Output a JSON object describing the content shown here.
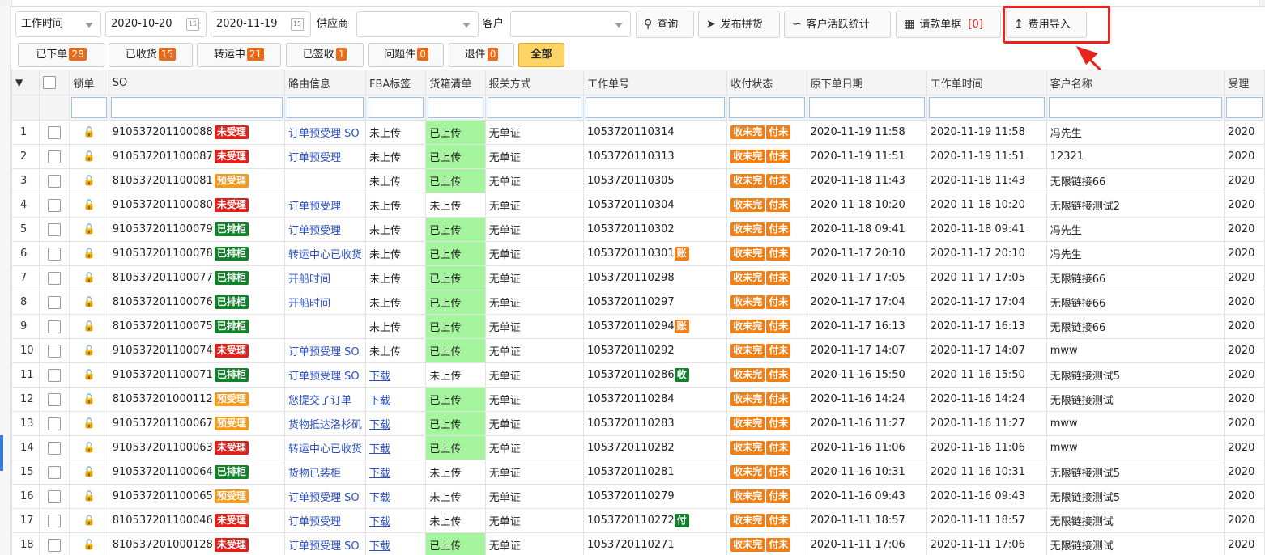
{
  "toolbar": {
    "date_type": "工作时间",
    "date_from": "2020-10-20",
    "date_to": "2020-11-19",
    "supplier_label": "供应商",
    "supplier_value": "",
    "customer_label": "客户",
    "customer_value": "",
    "query_label": "查询",
    "publish_label": "发布拼货",
    "stats_label": "客户活跃统计",
    "invoice_label": "请款单据",
    "invoice_count": "[0]",
    "import_label": "费用导入"
  },
  "status_tabs": [
    {
      "label": "已下单",
      "count": "28"
    },
    {
      "label": "已收货",
      "count": "15"
    },
    {
      "label": "转运中",
      "count": "21"
    },
    {
      "label": "已签收",
      "count": "1"
    },
    {
      "label": "问题件",
      "count": "0"
    },
    {
      "label": "退件",
      "count": "0"
    },
    {
      "label": "全部",
      "count": ""
    }
  ],
  "columns": [
    "锁单",
    "SO",
    "路由信息",
    "FBA标签",
    "货箱清单",
    "报关方式",
    "工作单号",
    "收付状态",
    "原下单日期",
    "工作单时间",
    "客户名称",
    "受理"
  ],
  "status_colors": {
    "未受理": "#e0201a",
    "预受理": "#f39a1a",
    "已排柜": "#12822a",
    "账": "#ef7f17",
    "收": "#12822a",
    "付": "#12822a",
    "uploaded_bg": "#a5f59e",
    "highlight": "#e8241c"
  },
  "receive_label": "收未完",
  "pay_label": "付未",
  "rows": [
    {
      "no": "1",
      "so": "910537201100088",
      "status": "未受理",
      "route": "订单预受理 SO",
      "fba": "未上传",
      "box": "已上传",
      "customs": "无单证",
      "work": "1053720110314",
      "badge": "",
      "orig": "2020-11-19 11:58",
      "wtime": "2020-11-19 11:58",
      "cust": "冯先生",
      "acc": "2020"
    },
    {
      "no": "2",
      "so": "910537201100087",
      "status": "未受理",
      "route": "订单预受理",
      "fba": "未上传",
      "box": "已上传",
      "customs": "无单证",
      "work": "1053720110313",
      "badge": "",
      "orig": "2020-11-19 11:51",
      "wtime": "2020-11-19 11:51",
      "cust": "12321",
      "acc": "2020"
    },
    {
      "no": "3",
      "so": "810537201100081",
      "status": "预受理",
      "route": "",
      "fba": "未上传",
      "box": "已上传",
      "customs": "无单证",
      "work": "1053720110305",
      "badge": "",
      "orig": "2020-11-18 11:43",
      "wtime": "2020-11-18 11:43",
      "cust": "无限链接66",
      "acc": "2020"
    },
    {
      "no": "4",
      "so": "910537201100080",
      "status": "未受理",
      "route": "订单预受理",
      "fba": "未上传",
      "box": "未上传",
      "customs": "无单证",
      "work": "1053720110304",
      "badge": "",
      "orig": "2020-11-18 10:20",
      "wtime": "2020-11-18 10:20",
      "cust": "无限链接测试2",
      "acc": "2020"
    },
    {
      "no": "5",
      "so": "910537201100079",
      "status": "已排柜",
      "route": "订单预受理",
      "fba": "未上传",
      "box": "已上传",
      "customs": "无单证",
      "work": "1053720110302",
      "badge": "",
      "orig": "2020-11-18 09:41",
      "wtime": "2020-11-18 09:41",
      "cust": "冯先生",
      "acc": "2020"
    },
    {
      "no": "6",
      "so": "910537201100078",
      "status": "已排柜",
      "route": "转运中心已收货",
      "fba": "未上传",
      "box": "已上传",
      "customs": "无单证",
      "work": "1053720110301",
      "badge": "账",
      "orig": "2020-11-17 20:10",
      "wtime": "2020-11-17 20:10",
      "cust": "冯先生",
      "acc": "2020"
    },
    {
      "no": "7",
      "so": "810537201100077",
      "status": "已排柜",
      "route": "开船时间",
      "fba": "未上传",
      "box": "已上传",
      "customs": "无单证",
      "work": "1053720110298",
      "badge": "",
      "orig": "2020-11-17 17:05",
      "wtime": "2020-11-17 17:05",
      "cust": "无限链接66",
      "acc": "2020"
    },
    {
      "no": "8",
      "so": "810537201100076",
      "status": "已排柜",
      "route": "开船时间",
      "fba": "未上传",
      "box": "已上传",
      "customs": "无单证",
      "work": "1053720110297",
      "badge": "",
      "orig": "2020-11-17 17:04",
      "wtime": "2020-11-17 17:04",
      "cust": "无限链接66",
      "acc": "2020"
    },
    {
      "no": "9",
      "so": "810537201100075",
      "status": "已排柜",
      "route": "",
      "fba": "未上传",
      "box": "已上传",
      "customs": "无单证",
      "work": "1053720110294",
      "badge": "账",
      "orig": "2020-11-17 16:13",
      "wtime": "2020-11-17 16:13",
      "cust": "无限链接66",
      "acc": "2020"
    },
    {
      "no": "10",
      "so": "910537201100074",
      "status": "未受理",
      "route": "订单预受理 SO",
      "fba": "未上传",
      "box": "已上传",
      "customs": "无单证",
      "work": "1053720110292",
      "badge": "",
      "orig": "2020-11-17 14:07",
      "wtime": "2020-11-17 14:07",
      "cust": "mww",
      "acc": "2020"
    },
    {
      "no": "11",
      "so": "910537201100071",
      "status": "已排柜",
      "route": "订单预受理 SO",
      "fba": "下载",
      "box": "未上传",
      "customs": "无单证",
      "work": "1053720110286",
      "badge": "收",
      "orig": "2020-11-16 15:50",
      "wtime": "2020-11-16 15:50",
      "cust": "无限链接测试5",
      "acc": "2020"
    },
    {
      "no": "12",
      "so": "810537201000112",
      "status": "预受理",
      "route": "您提交了订单",
      "fba": "下载",
      "box": "已上传",
      "customs": "无单证",
      "work": "1053720110284",
      "badge": "",
      "orig": "2020-11-16 14:24",
      "wtime": "2020-11-16 14:24",
      "cust": "无限链接测试",
      "acc": "2020"
    },
    {
      "no": "13",
      "so": "910537201100067",
      "status": "预受理",
      "route": "货物抵达洛杉矶",
      "fba": "下载",
      "box": "已上传",
      "customs": "无单证",
      "work": "1053720110283",
      "badge": "",
      "orig": "2020-11-16 11:27",
      "wtime": "2020-11-16 11:27",
      "cust": "mww",
      "acc": "2020"
    },
    {
      "no": "14",
      "so": "910537201100063",
      "status": "未受理",
      "route": "转运中心已收货",
      "fba": "下载",
      "box": "已上传",
      "customs": "无单证",
      "work": "1053720110282",
      "badge": "",
      "orig": "2020-11-16 11:06",
      "wtime": "2020-11-16 11:06",
      "cust": "mww",
      "acc": "2020"
    },
    {
      "no": "15",
      "so": "910537201100064",
      "status": "已排柜",
      "route": "货物已装柜",
      "fba": "下载",
      "box": "未上传",
      "customs": "无单证",
      "work": "1053720110281",
      "badge": "",
      "orig": "2020-11-16 10:31",
      "wtime": "2020-11-16 10:31",
      "cust": "无限链接测试5",
      "acc": "2020"
    },
    {
      "no": "16",
      "so": "910537201100065",
      "status": "预受理",
      "route": "订单预受理 SO",
      "fba": "下载",
      "box": "未上传",
      "customs": "无单证",
      "work": "1053720110279",
      "badge": "",
      "orig": "2020-11-16 09:43",
      "wtime": "2020-11-16 09:43",
      "cust": "无限链接测试5",
      "acc": "2020"
    },
    {
      "no": "17",
      "so": "810537201100046",
      "status": "未受理",
      "route": "订单预受理",
      "fba": "下载",
      "box": "未上传",
      "customs": "无单证",
      "work": "1053720110272",
      "badge": "付",
      "orig": "2020-11-11 18:57",
      "wtime": "2020-11-11 18:57",
      "cust": "无限链接测试",
      "acc": "2020"
    },
    {
      "no": "18",
      "so": "810537201000128",
      "status": "未受理",
      "route": "订单预受理 SO",
      "fba": "下载",
      "box": "已上传",
      "customs": "无单证",
      "work": "1053720110271",
      "badge": "",
      "orig": "2020-11-11 17:06",
      "wtime": "2020-11-11 17:06",
      "cust": "无限链接测试",
      "acc": "2020"
    }
  ]
}
